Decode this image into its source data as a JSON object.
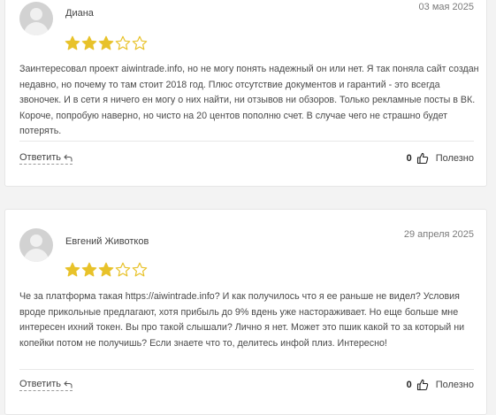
{
  "colors": {
    "star_filled": "#e8c22a",
    "star_empty": "#e8c22a",
    "background": "#f3f3f3",
    "card": "#ffffff"
  },
  "reviews": [
    {
      "author": "Диана",
      "date": "03 мая 2025",
      "rating": 3,
      "rating_max": 5,
      "text": "Заинтересовал проект aiwintrade.info, но не могу понять надежный он или нет. Я так поняла сайт создан недавно, но почему то там стоит 2018 год. Плюс отсутствие документов и гарантий - это всегда звоночек. И в сети я ничего ен могу о них найти, ни отзывов ни обзоров. Только рекламные посты в ВК. Короче, попробую наверно, но чисто на 20 центов пополню счет. В случае чего не страшно будет потерять.",
      "reply_label": "Ответить",
      "helpful_count": "0",
      "helpful_label": "Полезно"
    },
    {
      "author": "Евгений Животков",
      "date": "29 апреля 2025",
      "rating": 3,
      "rating_max": 5,
      "text": "Че за платформа такая https://aiwintrade.info? И как получилось что я ее раньше не видел? Условия вроде прикольные предлагают, хотя прибыль до 9% вдень уже настораживает. Но еще больше мне интересен ихний токен. Вы про такой слышали? Лично я нет. Может это пшик какой то за который ни копейки потом не получишь? Если знаете что то, делитесь инфой плиз. Интересно!",
      "reply_label": "Ответить",
      "helpful_count": "0",
      "helpful_label": "Полезно"
    }
  ]
}
